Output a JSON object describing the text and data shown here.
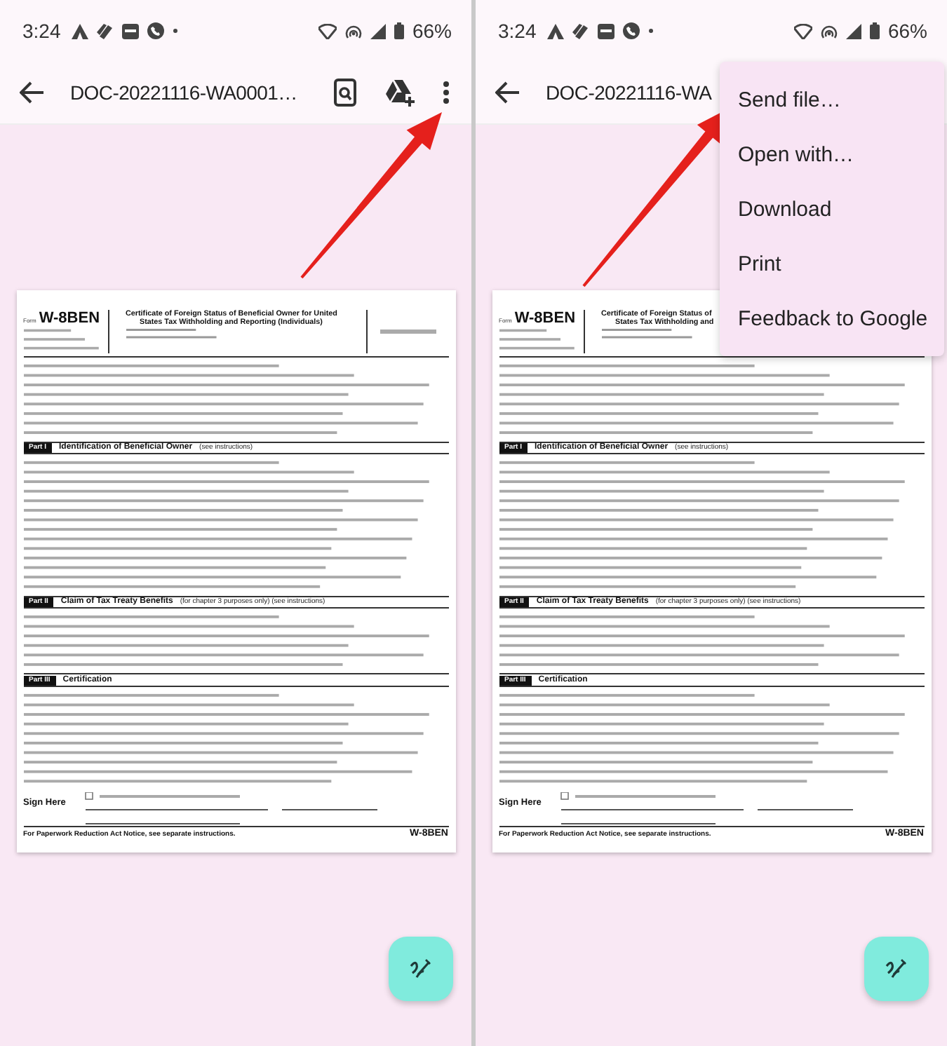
{
  "panels": [
    {
      "status_bar": {
        "time": "3:24",
        "battery": "66%"
      },
      "app_bar": {
        "title": "DOC-20221116-WA0001…",
        "actions_visible": true
      },
      "document": {
        "form_prefix": "Form",
        "form_number": "W-8BEN",
        "title_lines": [
          "Certificate of Foreign Status of Beneficial Owner for United",
          "States Tax Withholding and Reporting (Individuals)"
        ],
        "parts": [
          {
            "tag": "Part I",
            "heading": "Identification of Beneficial Owner",
            "note": "(see instructions)"
          },
          {
            "tag": "Part II",
            "heading": "Claim of Tax Treaty Benefits",
            "note": "(for chapter 3 purposes only) (see instructions)"
          },
          {
            "tag": "Part III",
            "heading": "Certification"
          }
        ],
        "sign_label": "Sign Here",
        "footer_note": "For Paperwork Reduction Act Notice, see separate instructions.",
        "footer_form": "W-8BEN"
      }
    },
    {
      "status_bar": {
        "time": "3:24",
        "battery": "66%"
      },
      "app_bar": {
        "title": "DOC-20221116-WA"
      },
      "document": {
        "form_prefix": "Form",
        "form_number": "W-8BEN",
        "title_lines": [
          "Certificate of Foreign Status of",
          "States Tax Withholding and"
        ],
        "parts": [
          {
            "tag": "Part I",
            "heading": "Identification of Beneficial Owner",
            "note": "(see instructions)"
          },
          {
            "tag": "Part II",
            "heading": "Claim of Tax Treaty Benefits",
            "note": "(for chapter 3 purposes only) (see instructions)"
          },
          {
            "tag": "Part III",
            "heading": "Certification"
          }
        ],
        "sign_label": "Sign Here",
        "footer_note": "For Paperwork Reduction Act Notice, see separate instructions.",
        "footer_form": "W-8BEN"
      },
      "menu": {
        "items": [
          "Send file…",
          "Open with…",
          "Download",
          "Print",
          "Feedback to Google"
        ]
      }
    }
  ]
}
